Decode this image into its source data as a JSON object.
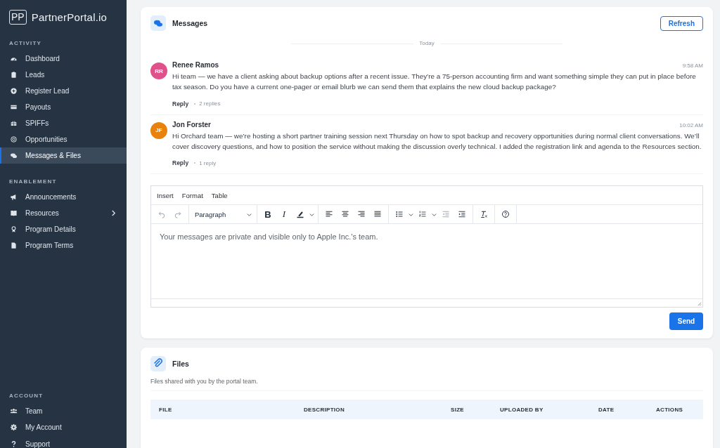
{
  "brand": {
    "mark": "PP",
    "name": "PartnerPortal.io"
  },
  "sidebar": {
    "sections": [
      {
        "title": "ACTIVITY",
        "items": [
          {
            "label": "Dashboard",
            "selected": false
          },
          {
            "label": "Leads",
            "selected": false
          },
          {
            "label": "Register Lead",
            "selected": false
          },
          {
            "label": "Payouts",
            "selected": false
          },
          {
            "label": "SPIFFs",
            "selected": false
          },
          {
            "label": "Opportunities",
            "selected": false
          },
          {
            "label": "Messages & Files",
            "selected": true
          }
        ]
      },
      {
        "title": "ENABLEMENT",
        "items": [
          {
            "label": "Announcements",
            "selected": false
          },
          {
            "label": "Resources",
            "selected": false,
            "expandable": true
          },
          {
            "label": "Program Details",
            "selected": false
          },
          {
            "label": "Program Terms",
            "selected": false
          }
        ]
      },
      {
        "title": "ACCOUNT",
        "items": [
          {
            "label": "Team",
            "selected": false
          },
          {
            "label": "My Account",
            "selected": false
          },
          {
            "label": "Support",
            "selected": false
          }
        ]
      }
    ]
  },
  "messages": {
    "title": "Messages",
    "refresh": "Refresh",
    "day": "Today",
    "items": [
      {
        "initials": "RR",
        "color": "#e0508a",
        "author": "Renee Ramos",
        "time": "9:58 AM",
        "text": "Hi team — we have a client asking about backup options after a recent issue. They’re a 75-person accounting firm and want something simple they can put in place before tax season. Do you have a current one-pager or email blurb we can send them that explains the new cloud backup package?",
        "reply": "Reply",
        "replies": "2 replies"
      },
      {
        "initials": "JF",
        "color": "#e8820c",
        "author": "Jon Forster",
        "time": "10:02 AM",
        "text": "Hi Orchard team — we’re hosting a short partner training session next Thursday on how to spot backup and recovery opportunities during normal client conversations. We’ll cover discovery questions, and how to position the service without making the discussion overly technical. I added the registration link and agenda to the Resources section.",
        "reply": "Reply",
        "replies": "1 reply"
      }
    ],
    "editor": {
      "menus": [
        "Insert",
        "Format",
        "Table"
      ],
      "block_format": "Paragraph",
      "bold": "B",
      "italic": "I",
      "placeholder": "Your messages are private and visible only to Apple Inc.'s team."
    },
    "send": "Send"
  },
  "files": {
    "title": "Files",
    "description": "Files shared with you by the portal team.",
    "columns": [
      "FILE",
      "DESCRIPTION",
      "SIZE",
      "UPLOADED BY",
      "DATE",
      "ACTIONS"
    ]
  }
}
